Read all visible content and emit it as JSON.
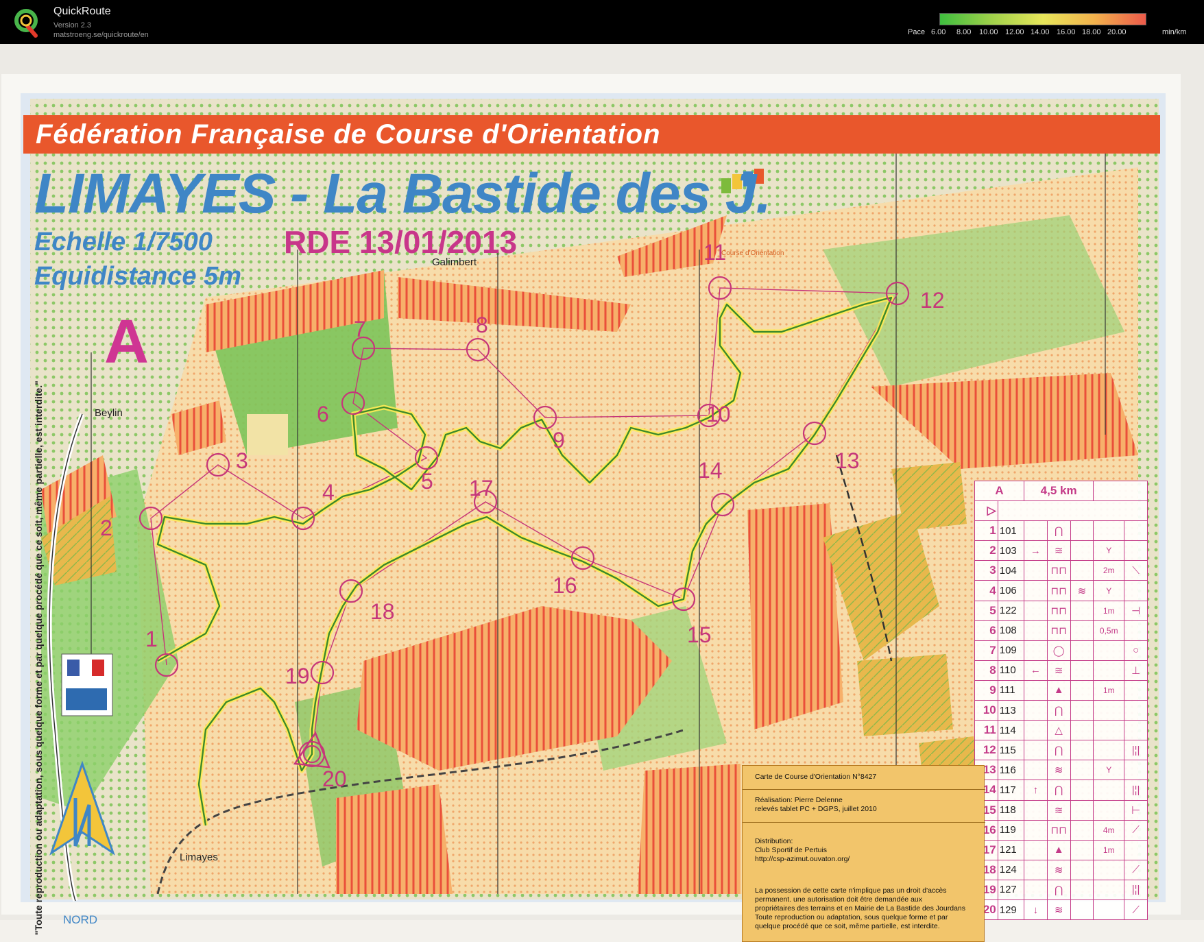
{
  "app": {
    "name": "QuickRoute",
    "version": "Version 2.3",
    "url": "matstroeng.se/quickroute/en"
  },
  "pace_legend": {
    "label": "Pace",
    "ticks": [
      "6.00",
      "8.00",
      "10.00",
      "12.00",
      "14.00",
      "16.00",
      "18.00",
      "20.00"
    ],
    "unit": "min/km",
    "colors": [
      "#3fbf3f",
      "#9fd04a",
      "#e7e65a",
      "#f2b24d",
      "#ec5a4a"
    ]
  },
  "map": {
    "federation": "Fédération Française de Course d'Orientation",
    "title": "LIMAYES - La Bastide des J.",
    "scale": "Echelle 1/7500",
    "equidistance": "Equidistance 5m",
    "event": "RDE 13/01/2013",
    "course_letter": "A",
    "place_names": [
      "Galimbert",
      "Beylin",
      "Limayes"
    ],
    "north_label": "NORD",
    "ffco_caption": "Course d'Orientation",
    "vertical_notice": "\"Toute reproduction ou adaptation, sous quelque forme et par quelque procédé que ce soit, même partielle, est interdite.\"",
    "control_numbers": [
      "1",
      "2",
      "3",
      "4",
      "5",
      "6",
      "7",
      "8",
      "9",
      "10",
      "11",
      "12",
      "13",
      "14",
      "15",
      "16",
      "17",
      "18",
      "19",
      "20"
    ],
    "colors": {
      "banner": "#e9572c",
      "title_blue": "#3f86c6",
      "magenta": "#c6367a",
      "forest_green": "#6db84f",
      "open_orange": "#f6a25a",
      "rough_yellow": "#f2cf6a",
      "route_green": "#3d8a2a"
    }
  },
  "control_card": {
    "course": "A",
    "length": "4,5 km",
    "rows": [
      {
        "num": "1",
        "code": "101",
        "c1": "",
        "sym": "⋂",
        "c3": "",
        "dim": "",
        "c5": ""
      },
      {
        "num": "2",
        "code": "103",
        "c1": "→",
        "sym": "≋",
        "c3": "",
        "dim": "Y",
        "c5": ""
      },
      {
        "num": "3",
        "code": "104",
        "c1": "",
        "sym": "⊓⊓",
        "c3": "",
        "dim": "2m",
        "c5": "⟍"
      },
      {
        "num": "4",
        "code": "106",
        "c1": "",
        "sym": "⊓⊓",
        "c3": "≋",
        "dim": "Y",
        "c5": ""
      },
      {
        "num": "5",
        "code": "122",
        "c1": "",
        "sym": "⊓⊓",
        "c3": "",
        "dim": "1m",
        "c5": "⊣"
      },
      {
        "num": "6",
        "code": "108",
        "c1": "",
        "sym": "⊓⊓",
        "c3": "",
        "dim": "0,5m",
        "c5": ""
      },
      {
        "num": "7",
        "code": "109",
        "c1": "",
        "sym": "◯",
        "c3": "",
        "dim": "",
        "c5": "○"
      },
      {
        "num": "8",
        "code": "110",
        "c1": "←",
        "sym": "≋",
        "c3": "",
        "dim": "",
        "c5": "⊥"
      },
      {
        "num": "9",
        "code": "111",
        "c1": "",
        "sym": "▲",
        "c3": "",
        "dim": "1m",
        "c5": ""
      },
      {
        "num": "10",
        "code": "113",
        "c1": "",
        "sym": "⋂",
        "c3": "",
        "dim": "",
        "c5": ""
      },
      {
        "num": "11",
        "code": "114",
        "c1": "",
        "sym": "△",
        "c3": "",
        "dim": "",
        "c5": ""
      },
      {
        "num": "12",
        "code": "115",
        "c1": "",
        "sym": "⋂",
        "c3": "",
        "dim": "",
        "c5": "|¦|"
      },
      {
        "num": "13",
        "code": "116",
        "c1": "",
        "sym": "≋",
        "c3": "",
        "dim": "Y",
        "c5": ""
      },
      {
        "num": "14",
        "code": "117",
        "c1": "↑",
        "sym": "⋂",
        "c3": "",
        "dim": "",
        "c5": "|¦|"
      },
      {
        "num": "15",
        "code": "118",
        "c1": "",
        "sym": "≋",
        "c3": "",
        "dim": "",
        "c5": "⊢"
      },
      {
        "num": "16",
        "code": "119",
        "c1": "",
        "sym": "⊓⊓",
        "c3": "",
        "dim": "4m",
        "c5": "⟋"
      },
      {
        "num": "17",
        "code": "121",
        "c1": "",
        "sym": "▲",
        "c3": "",
        "dim": "1m",
        "c5": ""
      },
      {
        "num": "18",
        "code": "124",
        "c1": "",
        "sym": "≋",
        "c3": "",
        "dim": "",
        "c5": "⟋"
      },
      {
        "num": "19",
        "code": "127",
        "c1": "",
        "sym": "⋂",
        "c3": "",
        "dim": "",
        "c5": "|¦|"
      },
      {
        "num": "20",
        "code": "129",
        "c1": "↓",
        "sym": "≋",
        "c3": "",
        "dim": "",
        "c5": "⟋"
      }
    ]
  },
  "info_box": {
    "map_number": "Carte de Course d'Orientation N°8427",
    "realisation_1": "Réalisation: Pierre Delenne",
    "realisation_2": "relevés tablet PC + DGPS, juillet 2010",
    "distribution_1": "Distribution:",
    "distribution_2": "Club Sportif de Pertuis",
    "distribution_3": "http://csp-azimut.ouvaton.org/",
    "notice_1": "La possession de cette carte n'implique pas un droit d'accès",
    "notice_2": "permanent. une autorisation doit être demandée aux",
    "notice_3": "propriétaires des terrains et en Mairie de La Bastide des Jourdans",
    "notice_4": "Toute reproduction ou adaptation, sous quelque forme et par",
    "notice_5": "quelque procédé que ce soit, même partielle, est interdite."
  }
}
